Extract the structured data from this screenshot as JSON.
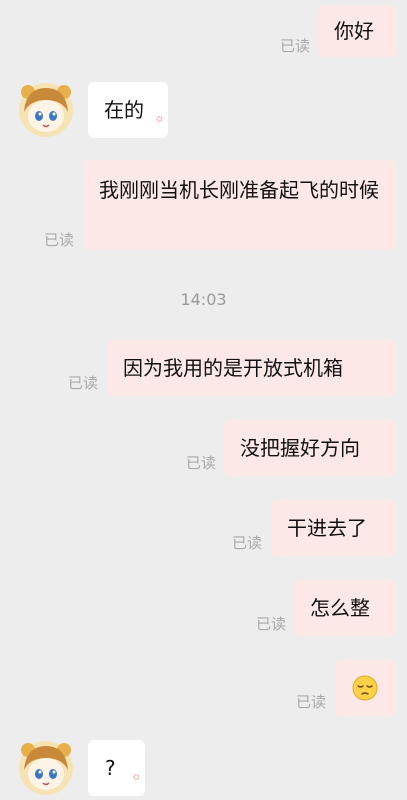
{
  "messages": [
    {
      "side": "right",
      "text": "你好",
      "status": "已读"
    },
    {
      "side": "left",
      "text": "在的"
    },
    {
      "side": "right",
      "text": "我刚刚当机长刚准备起飞的时候",
      "status": "已读"
    },
    {
      "type": "time",
      "text": "14:03"
    },
    {
      "side": "right",
      "text": "因为我用的是开放式机箱",
      "status": "已读"
    },
    {
      "side": "right",
      "text": "没把握好方向",
      "status": "已读"
    },
    {
      "side": "right",
      "text": "干进去了",
      "status": "已读"
    },
    {
      "side": "right",
      "text": "怎么整",
      "status": "已读"
    },
    {
      "side": "right",
      "emoji": "pensive-face",
      "status": "已读"
    },
    {
      "side": "left",
      "text": "?"
    }
  ],
  "colors": {
    "background": "#ededed",
    "bubble_right": "#fde8e8",
    "bubble_left": "#ffffff",
    "read_status": "#a9a9a9"
  }
}
